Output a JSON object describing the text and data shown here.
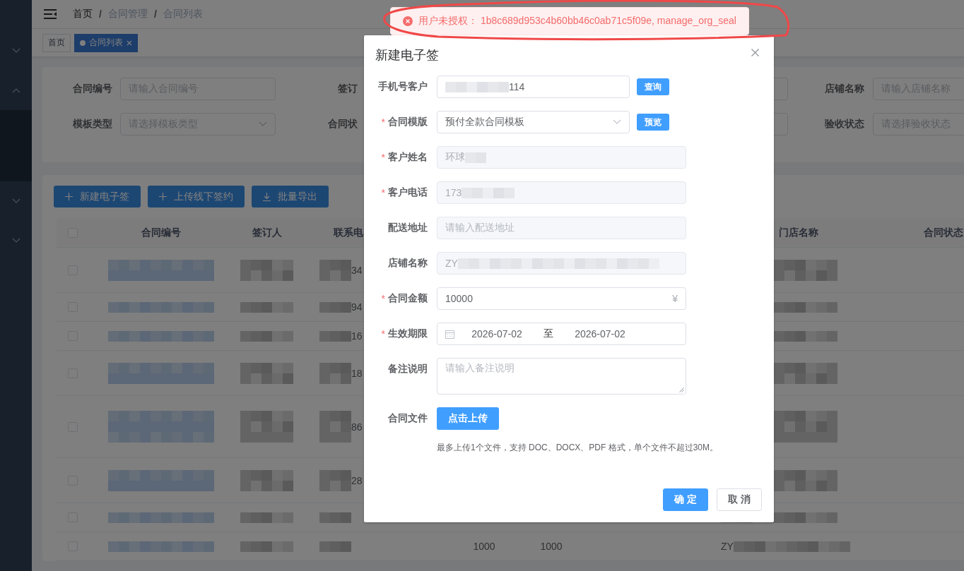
{
  "sidebar": {
    "items": [
      {
        "expanded": false
      },
      {
        "expanded": true
      },
      {
        "expanded": false
      },
      {
        "expanded": false
      }
    ]
  },
  "breadcrumb": {
    "separator": "/",
    "items": [
      "首页",
      "合同管理",
      "合同列表"
    ]
  },
  "tags": [
    {
      "label": "首页",
      "selected": false
    },
    {
      "label": "合同列表",
      "selected": true
    }
  ],
  "filters": [
    [
      {
        "label": "合同编号",
        "kind": "input",
        "placeholder": "请输入合同编号"
      },
      {
        "label": "签订",
        "kind": "input"
      },
      {
        "label": "店铺名称",
        "kind": "input",
        "placeholder": "请输入店铺名称"
      }
    ],
    [
      {
        "label": "模板类型",
        "kind": "select",
        "placeholder": "请选择模板类型"
      },
      {
        "label": "合同状",
        "kind": "select"
      },
      {
        "label": "验收状态",
        "kind": "select",
        "placeholder": "请选择验收状态"
      }
    ]
  ],
  "toolbar": [
    {
      "label": "新建电子签",
      "kind": "add"
    },
    {
      "label": "上传线下签约",
      "kind": "add"
    },
    {
      "label": "批量导出",
      "kind": "export"
    }
  ],
  "table": {
    "all_checked": false,
    "columns": [
      {
        "label": "合同编号"
      },
      {
        "label": "签订人"
      },
      {
        "label": "联系电"
      },
      null,
      null,
      null,
      null,
      {
        "label": "门店名称"
      },
      {
        "label": "合同状态"
      }
    ],
    "rows": [
      {
        "checked": false,
        "kind": "double",
        "cells": [
          {
            "masked": true
          },
          {
            "masked": true
          },
          {
            "masked": true,
            "text": "34"
          },
          null,
          null,
          null,
          null,
          {
            "masked": true
          },
          null
        ]
      },
      {
        "checked": false,
        "kind": "single",
        "cells": [
          {
            "masked": true
          },
          {
            "masked": true
          },
          {
            "masked": true,
            "text": "94"
          },
          null,
          null,
          null,
          null,
          {
            "masked": true
          },
          null
        ]
      },
      {
        "checked": false,
        "kind": "single",
        "cells": [
          {
            "masked": true
          },
          {
            "masked": true
          },
          {
            "masked": true,
            "text": "16"
          },
          null,
          null,
          null,
          null,
          {
            "masked": true
          },
          null
        ]
      },
      {
        "checked": false,
        "kind": "double",
        "cells": [
          {
            "masked": true
          },
          {
            "masked": true
          },
          {
            "masked": true,
            "text": "18"
          },
          null,
          null,
          null,
          null,
          {
            "masked": true
          },
          null
        ]
      },
      {
        "checked": false,
        "kind": "triple",
        "cells": [
          {
            "masked": true
          },
          {
            "masked": true
          },
          {
            "masked": true,
            "text": "86"
          },
          null,
          null,
          null,
          null,
          {
            "masked": true
          },
          null
        ]
      },
      {
        "checked": false,
        "kind": "double",
        "cells": [
          {
            "masked": true
          },
          {
            "masked": true
          },
          {
            "masked": true,
            "text": "28"
          },
          null,
          null,
          null,
          null,
          {
            "masked": true
          },
          null
        ]
      },
      {
        "checked": false,
        "kind": "single",
        "cells": [
          {
            "masked": true
          },
          {
            "masked": true
          },
          {
            "masked": true
          },
          null,
          null,
          null,
          null,
          {
            "masked": true
          },
          null
        ]
      },
      {
        "checked": false,
        "kind": "single",
        "cells": [
          {
            "masked": true
          },
          {
            "masked": true
          },
          {
            "masked": true
          },
          null,
          {
            "text": "1000"
          },
          {
            "text": "1000"
          },
          null,
          {
            "masked": true,
            "text": "ZY"
          },
          null
        ]
      }
    ]
  },
  "toast": {
    "kind": "error",
    "message": "用户未授权： 1b8c689d953c4b60bb46c0ab71c5f09e, manage_org_seal",
    "annotated": true
  },
  "dialog": {
    "title": "新建电子签",
    "fields": [
      {
        "label": "手机号客户",
        "kind": "input",
        "value": "114",
        "masked": true,
        "action": "查询"
      },
      {
        "label": "合同模版",
        "mark": "*",
        "kind": "select",
        "value": "预付全款合同模板",
        "action": "预览"
      },
      {
        "label": "客户姓名",
        "mark": "*",
        "kind": "input",
        "value": "环球",
        "masked": true,
        "disabled": true
      },
      {
        "label": "客户电话",
        "mark": "*",
        "kind": "input",
        "value": "173",
        "masked": true,
        "disabled": true
      },
      {
        "label": "配送地址",
        "kind": "input",
        "placeholder": "请输入配送地址",
        "disabled": true
      },
      {
        "label": "店铺名称",
        "kind": "input",
        "value": "ZY",
        "masked": true,
        "disabled": true
      },
      {
        "label": "合同金额",
        "mark": "*",
        "kind": "input",
        "value": "10000",
        "suffix": "¥"
      },
      {
        "label": "生效期限",
        "mark": "*",
        "kind": "daterange",
        "start": "2026-07-02",
        "separator": "至",
        "end": "2026-07-02"
      },
      {
        "label": "备注说明",
        "kind": "textarea",
        "placeholder": "请输入备注说明"
      },
      {
        "label": "合同文件",
        "kind": "upload",
        "button": "点击上传",
        "hint": "最多上传1个文件，支持 DOC、DOCX、PDF 格式，单个文件不超过30M。"
      }
    ],
    "buttons": [
      {
        "label": "确 定",
        "kind": "primary"
      },
      {
        "label": "取 消",
        "kind": "default"
      }
    ]
  }
}
